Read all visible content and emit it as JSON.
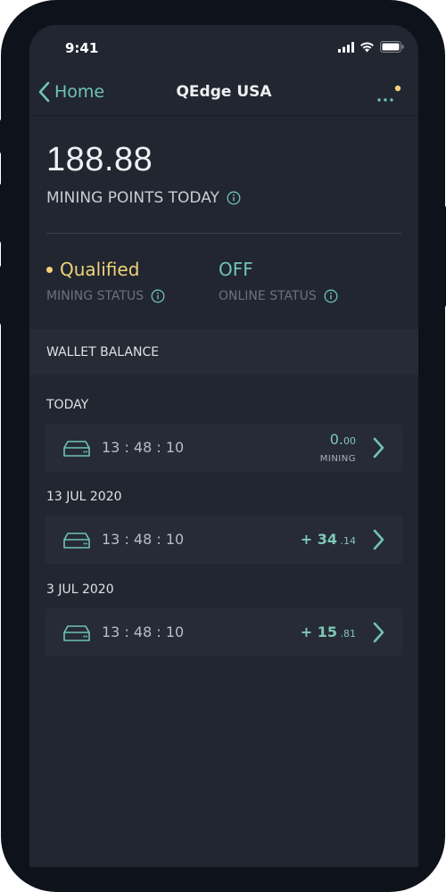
{
  "status_bar": {
    "time": "9:41"
  },
  "nav": {
    "back_label": "Home",
    "title": "QEdge USA"
  },
  "points": {
    "value": "188.88",
    "label": "MINING POINTS TODAY"
  },
  "mining_status": {
    "value": "Qualified",
    "label": "MINING STATUS"
  },
  "online_status": {
    "value": "OFF",
    "label": "ONLINE STATUS"
  },
  "wallet": {
    "title": "WALLET BALANCE"
  },
  "groups": [
    {
      "label": "TODAY",
      "time": "13 : 48 : 10",
      "amount_int": "0.",
      "amount_dec": "00",
      "sub": "MINING"
    },
    {
      "label": "13 JUL 2020",
      "time": "13 : 48 : 10",
      "amount_int": "+ 34",
      "amount_dec": " .14"
    },
    {
      "label": "3 JUL 2020",
      "time": "13 : 48 : 10",
      "amount_int": "+ 15",
      "amount_dec": " .81"
    }
  ],
  "colors": {
    "accent": "#6fc3b5",
    "qualified": "#f1d27a",
    "screen_bg": "#212630",
    "row_bg": "#262b35"
  }
}
